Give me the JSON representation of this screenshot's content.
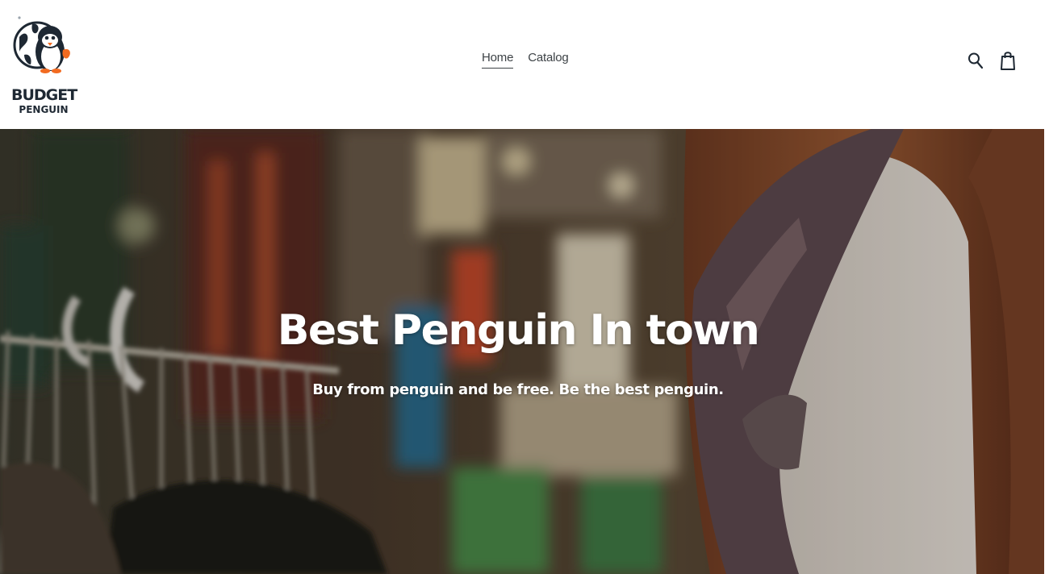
{
  "brand": {
    "line1": "BUDGET",
    "line2": "PENGUIN",
    "accent_color": "#f26b21",
    "ink_color": "#1e2833"
  },
  "nav": {
    "items": [
      {
        "label": "Home",
        "active": true
      },
      {
        "label": "Catalog",
        "active": false
      }
    ]
  },
  "header_icons": {
    "search": "search-icon",
    "cart": "shopping-bag-icon"
  },
  "hero": {
    "title": "Best Penguin In town",
    "subtitle": "Buy from penguin and be free. Be the best penguin.",
    "text_color": "#ffffff"
  }
}
